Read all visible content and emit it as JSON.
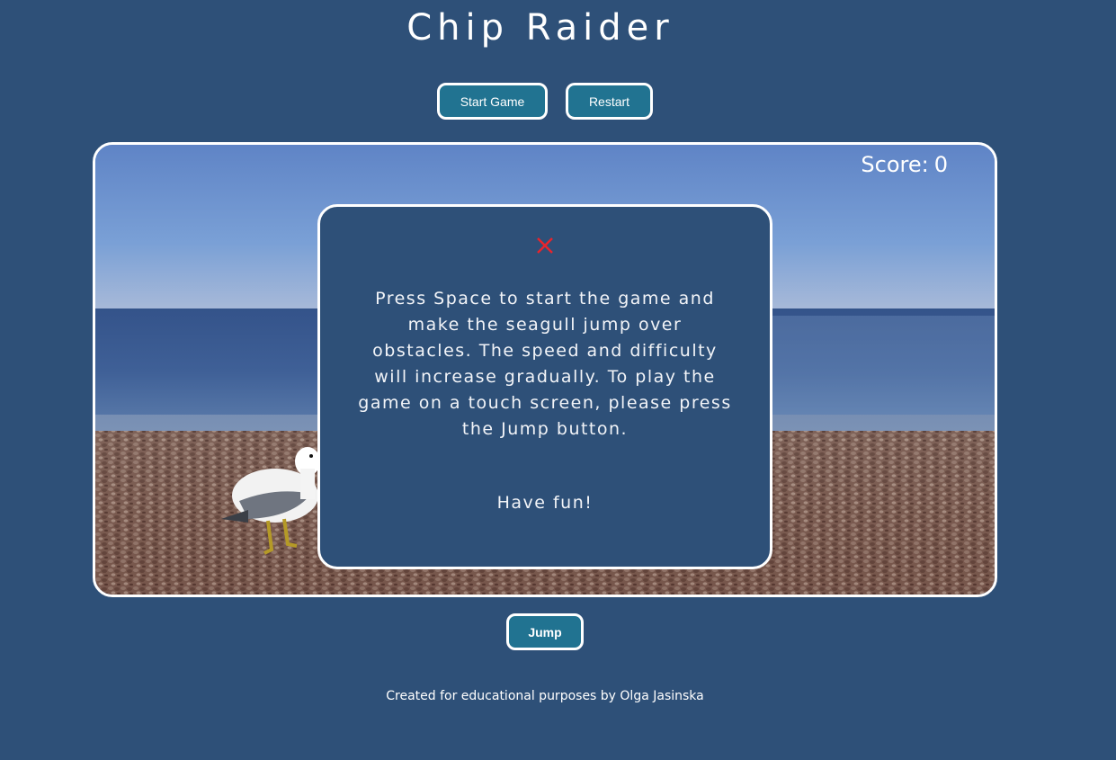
{
  "page": {
    "title": "Chip Raider",
    "footer": "Created for educational purposes by Olga Jasinska"
  },
  "controls": {
    "start_label": "Start Game",
    "restart_label": "Restart",
    "jump_label": "Jump"
  },
  "game": {
    "score_label": "Score:",
    "score_value": "0",
    "scene": "beach-with-seagull"
  },
  "modal": {
    "close_icon": "close-icon",
    "instructions": "Press Space to start the game and make the seagull jump over obstacles. The speed and difficulty will increase gradually. To play the game on a touch screen, please press the Jump button.",
    "farewell": "Have fun!"
  },
  "colors": {
    "background": "#2e5078",
    "button": "#217391",
    "close": "#e8242c",
    "border": "#ffffff"
  }
}
